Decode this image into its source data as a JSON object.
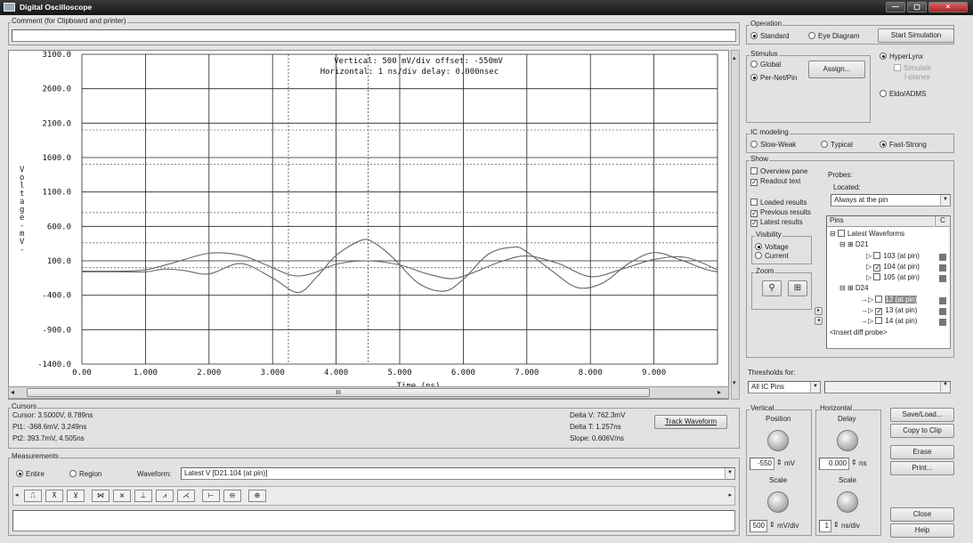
{
  "window": {
    "title": "Digital Oscilloscope",
    "controls": [
      "—",
      "▢",
      "×"
    ]
  },
  "comment": {
    "label": "Comment (for Clipboard and printer)",
    "value": ""
  },
  "plot": {
    "header_vertical": "Vertical: 500 mV/div  offset: -550mV",
    "header_horizontal": "Horizontal: 1 ns/div  delay: 0.000nsec",
    "ylabel": "Voltage -mV-",
    "xlabel": "Time  (ns)",
    "scroll_thumb": "III"
  },
  "chart_data": {
    "type": "line",
    "xlabel": "Time  (ns)",
    "ylabel": "Voltage -mV-",
    "xlim": [
      0,
      10
    ],
    "ylim": [
      -1400,
      3100
    ],
    "x_ticks": [
      "0.00",
      "1.000",
      "2.000",
      "3.000",
      "4.000",
      "5.000",
      "6.000",
      "7.000",
      "8.000",
      "9.000"
    ],
    "y_ticks": [
      "3100.0",
      "2600.0",
      "2100.0",
      "1600.0",
      "1100.0",
      "600.0",
      "100.0",
      "-400.0",
      "-900.0",
      "-1400.0"
    ],
    "thresholds_mv": [
      2000,
      1500,
      800,
      360,
      0,
      -400
    ],
    "cursor_ns": [
      3.249,
      4.505
    ],
    "series": [
      {
        "x": [
          0,
          0.6,
          1.0,
          1.3,
          1.6,
          2.0,
          2.5,
          3.0,
          3.4,
          3.7,
          4.0,
          4.4,
          4.6,
          4.9,
          5.3,
          5.7,
          6.0,
          6.4,
          6.8,
          7.0,
          7.4,
          7.8,
          8.2,
          8.6,
          9.0,
          9.4,
          9.8,
          10.0
        ],
        "y": [
          -60,
          -60,
          -60,
          -20,
          -40,
          -90,
          60,
          -150,
          -360,
          -130,
          180,
          400,
          360,
          140,
          -230,
          -340,
          -170,
          200,
          300,
          230,
          -50,
          -290,
          -220,
          60,
          220,
          120,
          -20,
          -60
        ]
      },
      {
        "x": [
          0,
          0.6,
          1.0,
          1.4,
          2.0,
          2.5,
          2.9,
          3.3,
          3.6,
          4.0,
          4.5,
          5.0,
          5.4,
          5.8,
          6.1,
          6.6,
          7.0,
          7.5,
          8.0,
          8.5,
          9.0,
          9.5,
          10.0
        ],
        "y": [
          -50,
          -50,
          -30,
          60,
          210,
          180,
          40,
          -110,
          -90,
          50,
          100,
          40,
          -80,
          -160,
          -90,
          90,
          170,
          60,
          -130,
          -20,
          120,
          150,
          -30
        ]
      }
    ]
  },
  "operation": {
    "label": "Operation",
    "standard": "Standard",
    "eye": "Eye Diagram",
    "start": "Start Simulation"
  },
  "stimulus": {
    "label": "Stimulus",
    "global": "Global",
    "pernet": "Per-Net/Pin",
    "assign": "Assign..."
  },
  "engine": {
    "hyperlynx": "HyperLynx",
    "simulate": "Simulate",
    "iplanes": "I-planes",
    "eldo": "Eldo/ADMS"
  },
  "ic_modeling": {
    "label": "IC modeling",
    "slow": "Slow-Weak",
    "typical": "Typical",
    "fast": "Fast-Strong"
  },
  "show": {
    "label": "Show",
    "overview": "Overview pane",
    "readout": "Readout text",
    "loaded": "Loaded results",
    "previous": "Previous results",
    "latest": "Latest results",
    "probes": "Probes:",
    "located": "Located:",
    "located_value": "Always at the pin",
    "visibility": "Visibility",
    "voltage": "Voltage",
    "current": "Current",
    "zoom": "Zoom",
    "pins_header": "Pins",
    "pins_header_right": "C",
    "tree": {
      "root": "Latest Waveforms",
      "d21": "D21",
      "p103": "103 (at pin)",
      "p104": "104 (at pin)",
      "p105": "105 (at pin)",
      "d24": "D24",
      "p12": "12 (at pin)",
      "p13": "13 (at pin)",
      "p14": "14 (at pin)",
      "insert": "<Insert diff probe>"
    }
  },
  "thresholds": {
    "label": "Thresholds for:",
    "value": "All IC Pins"
  },
  "cursors": {
    "label": "Cursors",
    "cursor": "Cursor: 3.5000V, 8.789ns",
    "pt1": "Pt1: -368.6mV, 3.249ns",
    "pt2": "Pt2: 393.7mV, 4.505ns",
    "delta_v": "Delta V: 762.3mV",
    "delta_t": "Delta T: 1.257ns",
    "slope": "Slope: 0.606V/ns",
    "track": "Track Waveform"
  },
  "measurements": {
    "label": "Measurements",
    "entire": "Entire",
    "region": "Region",
    "waveform_label": "Waveform:",
    "waveform_value": "Latest V [D21.104 (at pin)]"
  },
  "vertical": {
    "label": "Vertical",
    "position": "Position",
    "pos_value": "-550",
    "pos_unit": "mV",
    "scale": "Scale",
    "scale_value": "500",
    "scale_unit": "mV/div"
  },
  "horizontal": {
    "label": "Horizontal",
    "delay": "Delay",
    "delay_value": "0.000",
    "delay_unit": "ns",
    "scale": "Scale",
    "scale_value": "1",
    "scale_unit": "ns/div"
  },
  "buttons": {
    "save": "Save/Load...",
    "copy": "Copy to Clip",
    "erase": "Erase",
    "print": "Print...",
    "close": "Close",
    "help": "Help"
  }
}
